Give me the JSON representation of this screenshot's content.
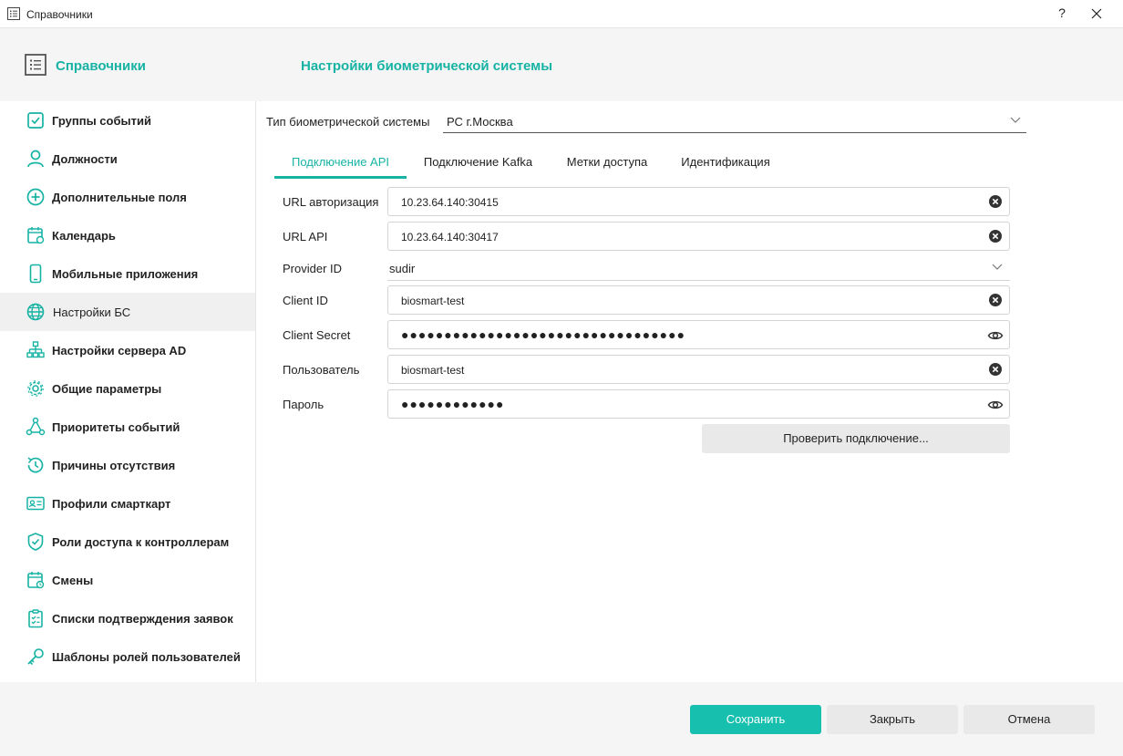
{
  "window": {
    "title": "Справочники",
    "help_label": "?"
  },
  "header": {
    "title": "Справочники",
    "page_title": "Настройки биометрической системы"
  },
  "colors": {
    "accent": "#16b3a4",
    "accent_button": "#16bfae",
    "active_item_bg": "#f0f0f0"
  },
  "sidebar": {
    "items": [
      {
        "label": "Группы событий",
        "icon": "checkbox-icon"
      },
      {
        "label": "Должности",
        "icon": "user-icon"
      },
      {
        "label": "Дополнительные поля",
        "icon": "plus-circle-icon"
      },
      {
        "label": "Календарь",
        "icon": "calendar-icon"
      },
      {
        "label": "Мобильные приложения",
        "icon": "phone-icon"
      },
      {
        "label": "Настройки БС",
        "icon": "globe-icon",
        "active": true
      },
      {
        "label": "Настройки сервера AD",
        "icon": "network-icon"
      },
      {
        "label": "Общие параметры",
        "icon": "gear-icon"
      },
      {
        "label": "Приоритеты событий",
        "icon": "triangle-nodes-icon"
      },
      {
        "label": "Причины отсутствия",
        "icon": "history-icon"
      },
      {
        "label": "Профили смарткарт",
        "icon": "id-card-icon"
      },
      {
        "label": "Роли доступа к контроллерам",
        "icon": "shield-check-icon"
      },
      {
        "label": "Смены",
        "icon": "calendar-clock-icon"
      },
      {
        "label": "Списки подтверждения заявок",
        "icon": "clipboard-check-icon"
      },
      {
        "label": "Шаблоны ролей пользователей",
        "icon": "key-icon"
      }
    ]
  },
  "content": {
    "type_label": "Тип биометрической системы",
    "type_value": "РС г.Москва",
    "tabs": [
      {
        "label": "Подключение API",
        "active": true
      },
      {
        "label": "Подключение Kafka"
      },
      {
        "label": "Метки доступа"
      },
      {
        "label": "Идентификация"
      }
    ],
    "fields": {
      "auth_url": {
        "label": "URL авторизация",
        "value": "10.23.64.140:30415"
      },
      "api_url": {
        "label": "URL API",
        "value": "10.23.64.140:30417"
      },
      "provider_id": {
        "label": "Provider ID",
        "value": "sudir"
      },
      "client_id": {
        "label": "Client ID",
        "value": "biosmart-test"
      },
      "client_secret": {
        "label": "Client Secret",
        "value": "●●●●●●●●●●●●●●●●●●●●●●●●●●●●●●●●●"
      },
      "user": {
        "label": "Пользователь",
        "value": "biosmart-test"
      },
      "password": {
        "label": "Пароль",
        "value": "●●●●●●●●●●●●"
      }
    },
    "check_button": "Проверить подключение..."
  },
  "footer": {
    "save_label": "Сохранить",
    "close_label": "Закрыть",
    "cancel_label": "Отмена"
  }
}
